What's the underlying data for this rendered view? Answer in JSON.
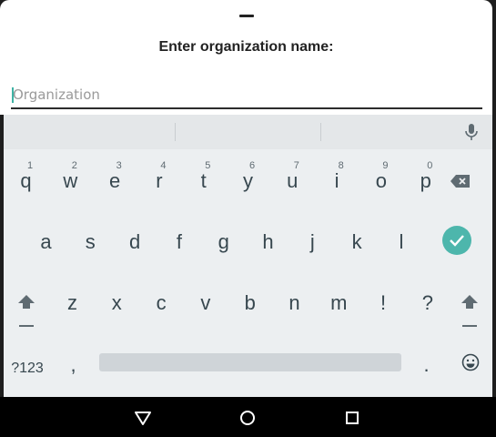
{
  "dialog": {
    "title": "Enter organization name:",
    "input_placeholder": "Organization",
    "input_value": ""
  },
  "keyboard": {
    "row1": [
      {
        "label": "q",
        "hint": "1"
      },
      {
        "label": "w",
        "hint": "2"
      },
      {
        "label": "e",
        "hint": "3"
      },
      {
        "label": "r",
        "hint": "4"
      },
      {
        "label": "t",
        "hint": "5"
      },
      {
        "label": "y",
        "hint": "6"
      },
      {
        "label": "u",
        "hint": "7"
      },
      {
        "label": "i",
        "hint": "8"
      },
      {
        "label": "o",
        "hint": "9"
      },
      {
        "label": "p",
        "hint": "0"
      }
    ],
    "row2": [
      "a",
      "s",
      "d",
      "f",
      "g",
      "h",
      "j",
      "k",
      "l"
    ],
    "row3": [
      "z",
      "x",
      "c",
      "v",
      "b",
      "n",
      "m",
      "!",
      "?"
    ],
    "symbols_label": "?123",
    "comma_label": ",",
    "period_label": ".",
    "icons": {
      "mic": "mic-icon",
      "backspace": "backspace-icon",
      "enter": "checkmark-icon",
      "shift": "shift-icon",
      "emoji": "emoji-icon"
    },
    "accent_color": "#4db6ac"
  },
  "navbar": {
    "icons": [
      "back-triangle-icon",
      "home-circle-icon",
      "recents-square-icon"
    ]
  }
}
